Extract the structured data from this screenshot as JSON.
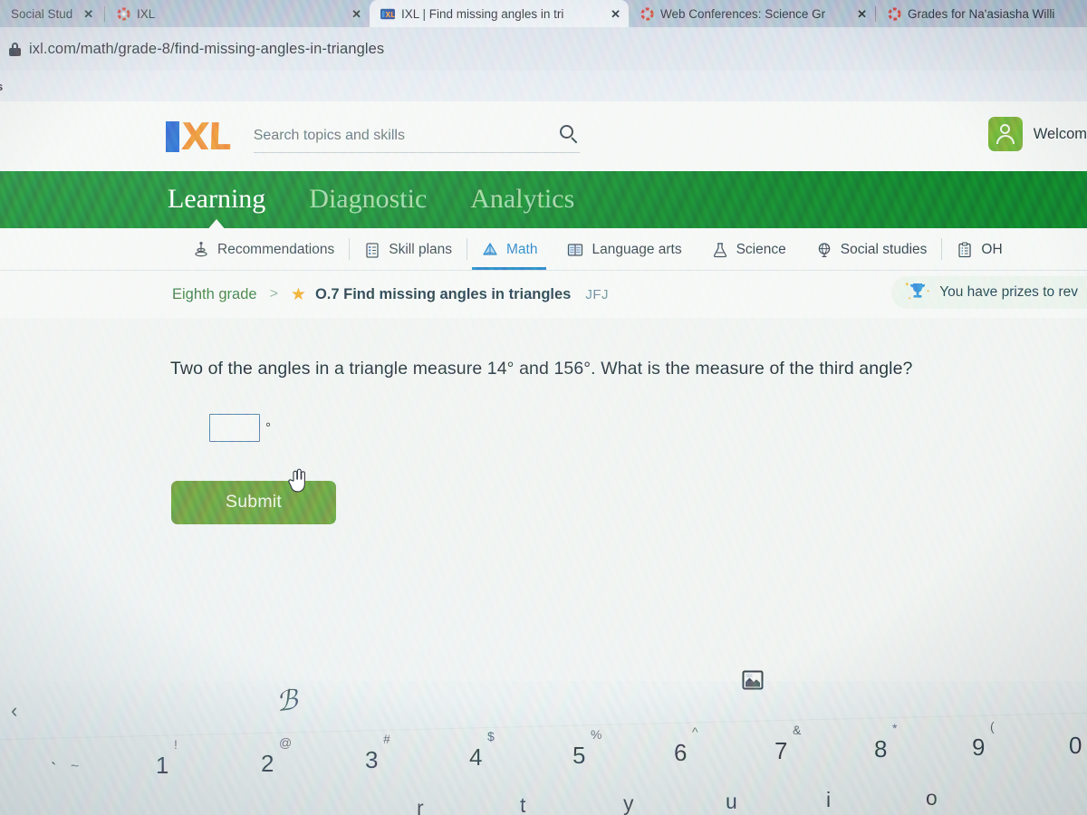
{
  "browser": {
    "tabs": [
      {
        "title": "Social Stud",
        "favicon": "none",
        "active": false,
        "has_close": true
      },
      {
        "title": "IXL",
        "favicon": "loading-spinner-icon",
        "active": false,
        "has_close": true
      },
      {
        "title": "IXL | Find missing angles in tri",
        "favicon": "ixl-favicon",
        "active": true,
        "has_close": true
      },
      {
        "title": "Web Conferences: Science Gr",
        "favicon": "loading-spinner-icon",
        "active": false,
        "has_close": true
      },
      {
        "title": "Grades for Na'asiasha Willi",
        "favicon": "loading-spinner-icon",
        "active": false,
        "has_close": false
      }
    ],
    "close_label": "✕",
    "url": "ixl.com/math/grade-8/find-missing-angles-in-triangles",
    "bookmark_sliver": "s"
  },
  "header": {
    "logo_text": "XL",
    "search_placeholder": "Search topics and skills",
    "welcome_text": "Welcom",
    "avatar_icon": "person-icon"
  },
  "main_nav": {
    "items": [
      {
        "label": "Learning",
        "active": true
      },
      {
        "label": "Diagnostic",
        "active": false
      },
      {
        "label": "Analytics",
        "active": false
      }
    ]
  },
  "subject_nav": {
    "items": [
      {
        "label": "Recommendations",
        "icon": "recommendations-icon",
        "active": false,
        "divider_before": false
      },
      {
        "label": "Skill plans",
        "icon": "skill-plans-icon",
        "active": false,
        "divider_before": true
      },
      {
        "label": "Math",
        "icon": "math-pyramid-icon",
        "active": true,
        "divider_before": true
      },
      {
        "label": "Language arts",
        "icon": "book-icon",
        "active": false,
        "divider_before": false
      },
      {
        "label": "Science",
        "icon": "flask-icon",
        "active": false,
        "divider_before": false
      },
      {
        "label": "Social studies",
        "icon": "globe-icon",
        "active": false,
        "divider_before": false
      },
      {
        "label": "OH",
        "icon": "clipboard-icon",
        "active": false,
        "divider_before": true
      }
    ]
  },
  "breadcrumb": {
    "grade": "Eighth grade",
    "separator": ">",
    "star_icon": "star-icon",
    "skill": "O.7 Find missing angles in triangles",
    "skill_code": "JFJ"
  },
  "prizes_banner": {
    "icon": "trophy-icon",
    "text": "You have prizes to rev"
  },
  "question": {
    "text": "Two of the angles in a triangle measure 14° and 156°. What is the measure of the third angle?",
    "angle_1": "14°",
    "angle_2": "156°",
    "answer_value": "",
    "answer_unit": "°",
    "submit_label": "Submit",
    "cursor_icon": "pointer-hand-cursor"
  },
  "keyboard": {
    "back_chevron": "‹",
    "scribble": "ℬ",
    "image_key_icon": "image-key-icon",
    "number_row": [
      {
        "main": "`",
        "shift": "~"
      },
      {
        "main": "1",
        "shift": "!"
      },
      {
        "main": "2",
        "shift": "@"
      },
      {
        "main": "3",
        "shift": "#"
      },
      {
        "main": "4",
        "shift": "$"
      },
      {
        "main": "5",
        "shift": "%"
      },
      {
        "main": "6",
        "shift": "^"
      },
      {
        "main": "7",
        "shift": "&"
      },
      {
        "main": "8",
        "shift": "*"
      },
      {
        "main": "9",
        "shift": "("
      },
      {
        "main": "0",
        "shift": ")"
      }
    ],
    "letter_row": [
      "r",
      "t",
      "y",
      "u",
      "i",
      "o"
    ]
  },
  "colors": {
    "ixl_green": "#0a7324",
    "ixl_orange": "#e8761e",
    "ixl_blue": "#1452c8",
    "math_blue": "#1a74bd",
    "submit_green": "#5c8f33",
    "star_gold": "#f0a11e"
  }
}
